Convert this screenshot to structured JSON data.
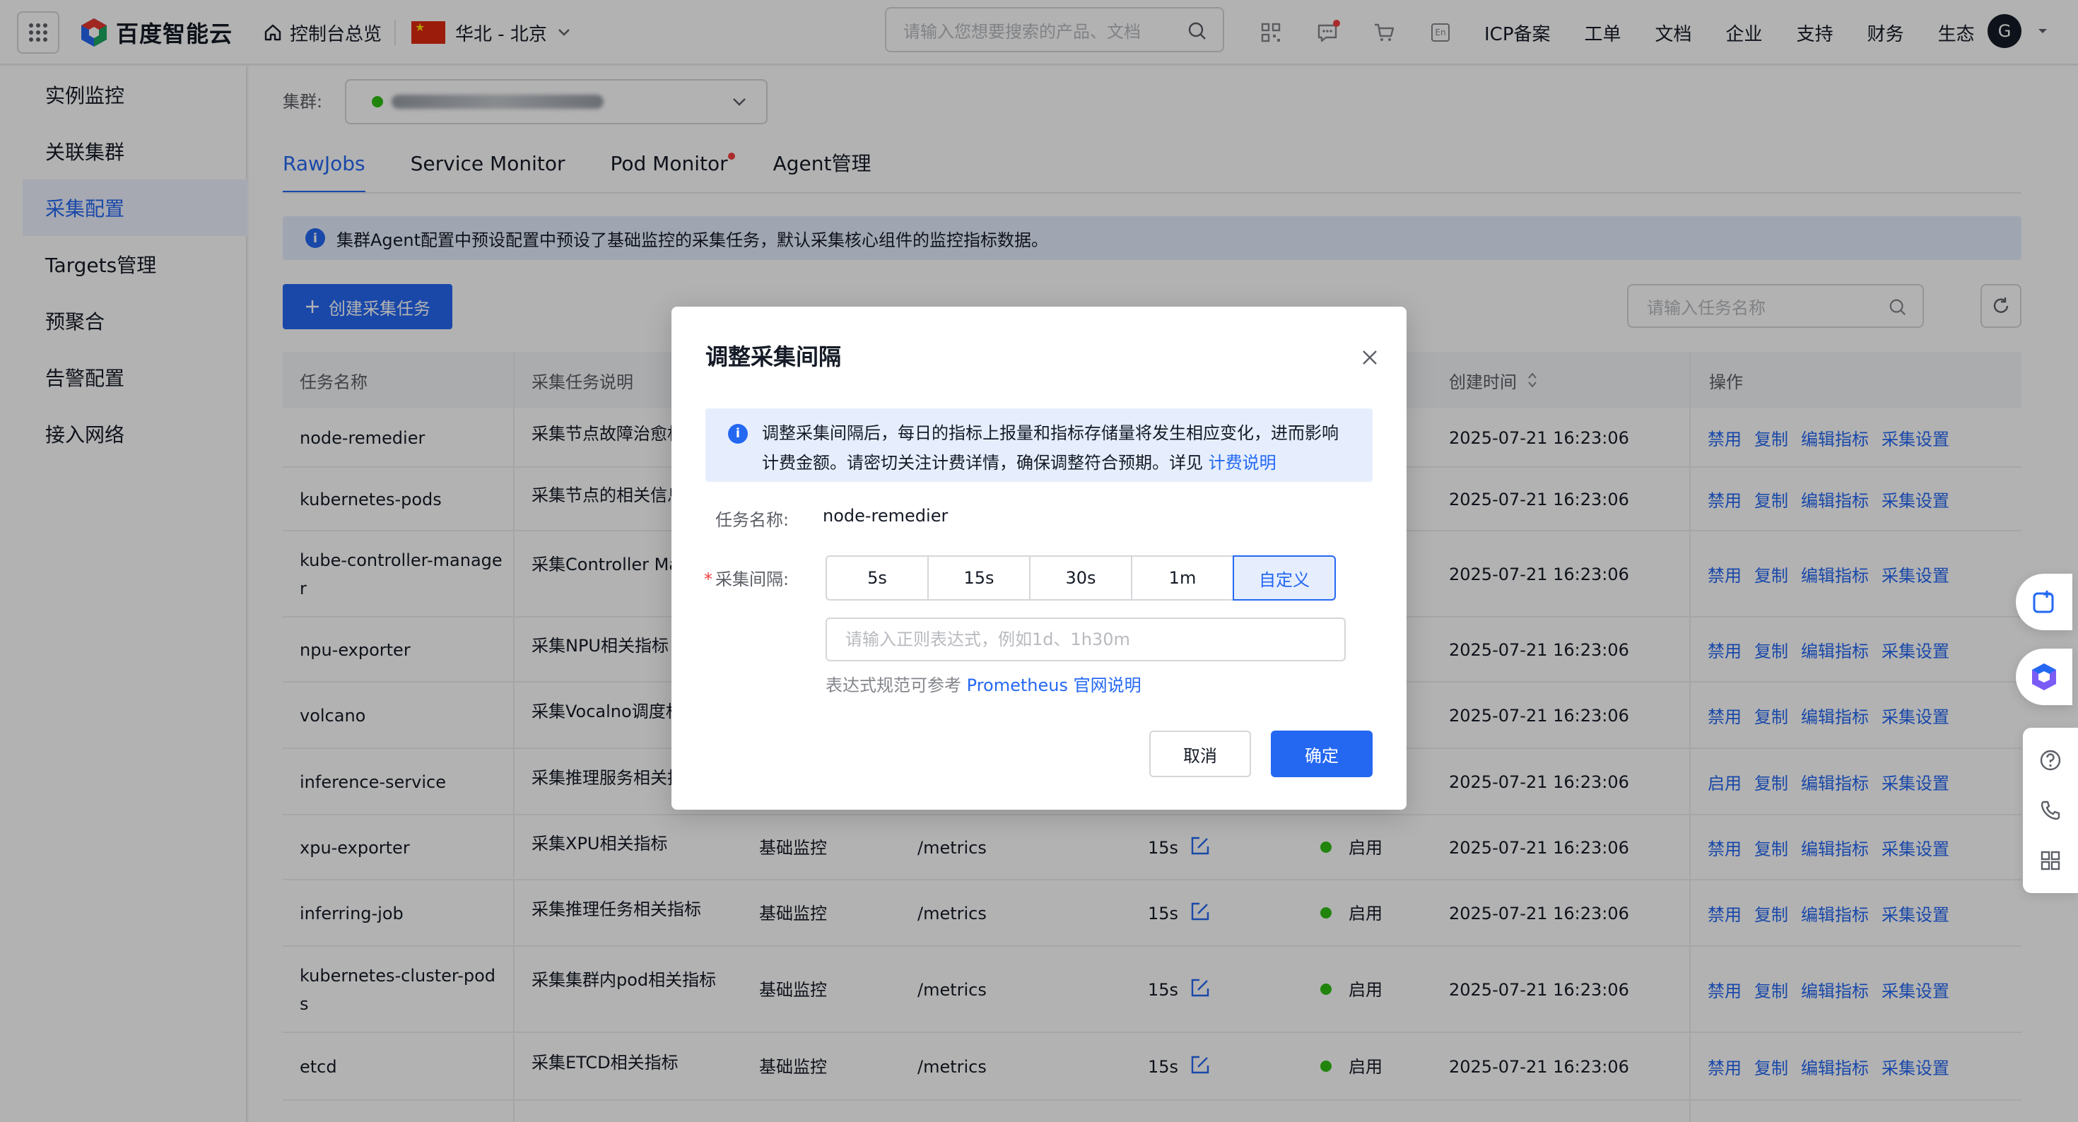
{
  "topbar": {
    "brand": "百度智能云",
    "console": "控制台总览",
    "region": "华北 - 北京",
    "search_placeholder": "请输入您想要搜索的产品、文档",
    "nav": [
      "ICP备案",
      "工单",
      "文档",
      "企业",
      "支持",
      "财务",
      "生态"
    ],
    "avatar": "G"
  },
  "sidebar": {
    "items": [
      {
        "label": "实例监控"
      },
      {
        "label": "关联集群"
      },
      {
        "label": "采集配置"
      },
      {
        "label": "Targets管理"
      },
      {
        "label": "预聚合"
      },
      {
        "label": "告警配置"
      },
      {
        "label": "接入网络"
      }
    ],
    "active": "采集配置"
  },
  "main": {
    "cluster_label": "集群:",
    "tabs": [
      {
        "label": "RawJobs"
      },
      {
        "label": "Service Monitor"
      },
      {
        "label": "Pod Monitor"
      },
      {
        "label": "Agent管理"
      }
    ],
    "banner": "集群Agent配置中预设配置中预设了基础监控的采集任务，默认采集核心组件的监控指标数据。",
    "create_button": "创建采集任务",
    "task_search_placeholder": "请输入任务名称",
    "table": {
      "headers": [
        "任务名称",
        "采集任务说明",
        "创建时间",
        "操作"
      ],
      "ops": [
        "禁用",
        "复制",
        "编辑指标",
        "采集设置"
      ],
      "rows": [
        {
          "name": "node-remedier",
          "desc": "采集节点故障治愈相",
          "time": "2025-07-21 16:23:06",
          "op1": "禁用"
        },
        {
          "name": "kubernetes-pods",
          "desc": "采集节点的相关信息",
          "time": "2025-07-21 16:23:06",
          "op1": "禁用"
        },
        {
          "name": "kube-controller-manage",
          "name2": "r",
          "desc": "采集Controller Ma",
          "time": "2025-07-21 16:23:06",
          "op1": "禁用"
        },
        {
          "name": "npu-exporter",
          "desc": "采集NPU相关指标",
          "time": "2025-07-21 16:23:06",
          "op1": "禁用"
        },
        {
          "name": "volcano",
          "desc": "采集Vocalno调度相",
          "time": "2025-07-21 16:23:06",
          "op1": "禁用"
        },
        {
          "name": "inference-service",
          "desc": "采集推理服务相关指",
          "time": "2025-07-21 16:23:06",
          "op1": "启用"
        },
        {
          "name": "xpu-exporter",
          "desc": "采集XPU相关指标",
          "type": "基础监控",
          "path": "/metrics",
          "interval": "15s",
          "status": "启用",
          "time": "2025-07-21 16:23:06",
          "op1": "禁用"
        },
        {
          "name": "inferring-job",
          "desc": "采集推理任务相关指标",
          "type": "基础监控",
          "path": "/metrics",
          "interval": "15s",
          "status": "启用",
          "time": "2025-07-21 16:23:06",
          "op1": "禁用"
        },
        {
          "name": "kubernetes-cluster-pod",
          "name2": "s",
          "desc": "采集集群内pod相关指标",
          "type": "基础监控",
          "path": "/metrics",
          "interval": "15s",
          "status": "启用",
          "time": "2025-07-21 16:23:06",
          "op1": "禁用"
        },
        {
          "name": "etcd",
          "desc": "采集ETCD相关指标",
          "type": "基础监控",
          "path": "/metrics",
          "interval": "15s",
          "status": "启用",
          "time": "2025-07-21 16:23:06",
          "op1": "禁用"
        }
      ]
    }
  },
  "modal": {
    "title": "调整采集间隔",
    "notice_line1": "调整采集间隔后，每日的指标上报量和指标存储量将发生相应变化，进而影响",
    "notice_line2": "计费金额。请密切关注计费详情，确保调整符合预期。详见 ",
    "notice_link": "计费说明",
    "task_label": "任务名称:",
    "task_value": "node-remedier",
    "interval_label": "采集间隔:",
    "interval_options": [
      "5s",
      "15s",
      "30s",
      "1m",
      "自定义"
    ],
    "interval_selected": "自定义",
    "regex_placeholder": "请输入正则表达式，例如1d、1h30m",
    "regex_value": "",
    "hint_text": "表达式规范可参考 ",
    "hint_link": "Prometheus 官网说明",
    "cancel": "取消",
    "ok": "确定"
  },
  "colors": {
    "primary": "#2468f2",
    "success": "#30bf13",
    "danger": "#f33e3e"
  }
}
